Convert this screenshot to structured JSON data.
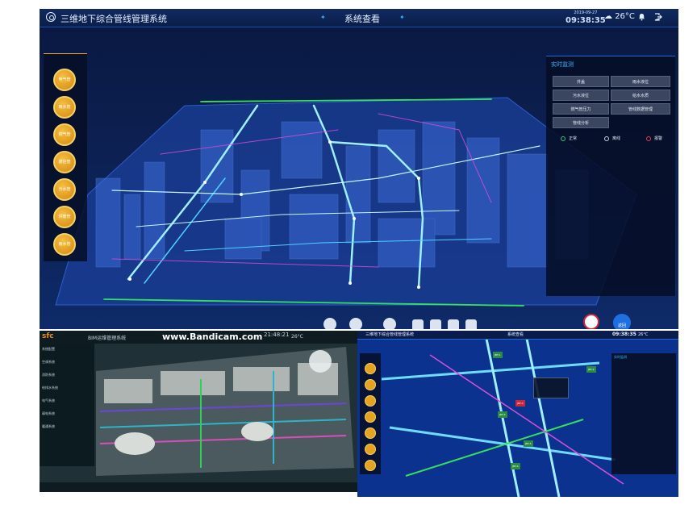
{
  "main": {
    "app_title": "三维地下综合管线管理系统",
    "center_title": "系统查看",
    "date": "2019-09-27",
    "time": "09:38:35",
    "weather": "26°C",
    "pipe_buttons": [
      "电气管",
      "雨水管",
      "燃气管",
      "通信管",
      "污水管",
      "供暖管",
      "雨水管"
    ],
    "right_panel": {
      "title": "实时监测",
      "buttons": [
        "井盖",
        "雨水液位",
        "污水液位",
        "给水水质",
        "燃气管压力",
        "管线数据管理",
        "管线分析"
      ],
      "status": [
        "正常",
        "离线",
        "报警"
      ]
    },
    "bottom_tool_icons": [
      "home-icon",
      "building-icon",
      "return-icon",
      "clock-icon",
      "grid-icon",
      "network-icon",
      "chart-icon"
    ],
    "back_label": "返回"
  },
  "bim": {
    "brand": "sfc",
    "title": "BIM运维管理系统",
    "watermark": "www.Bandicam.com",
    "time": "21:48:21",
    "weather": "26°C",
    "tree_header": "系统配置",
    "tree_items": [
      "空调系统",
      "消防系统",
      "给排水系统",
      "电气系统",
      "弱电系统",
      "暖通系统"
    ]
  },
  "sub": {
    "title": "三维地下综合管线管理系统",
    "center": "系统查看",
    "time": "09:38:35",
    "weather": "26°C",
    "panel_title": "实时监测",
    "tags": [
      "JBT-1",
      "JBT-2",
      "JBT-3",
      "JBT-4",
      "JBT-5",
      "JBT-6"
    ]
  },
  "colors": {
    "accent": "#e5a321",
    "primary": "#38b6ff",
    "alarm": "#c8283a",
    "normal": "#2b8a45"
  }
}
